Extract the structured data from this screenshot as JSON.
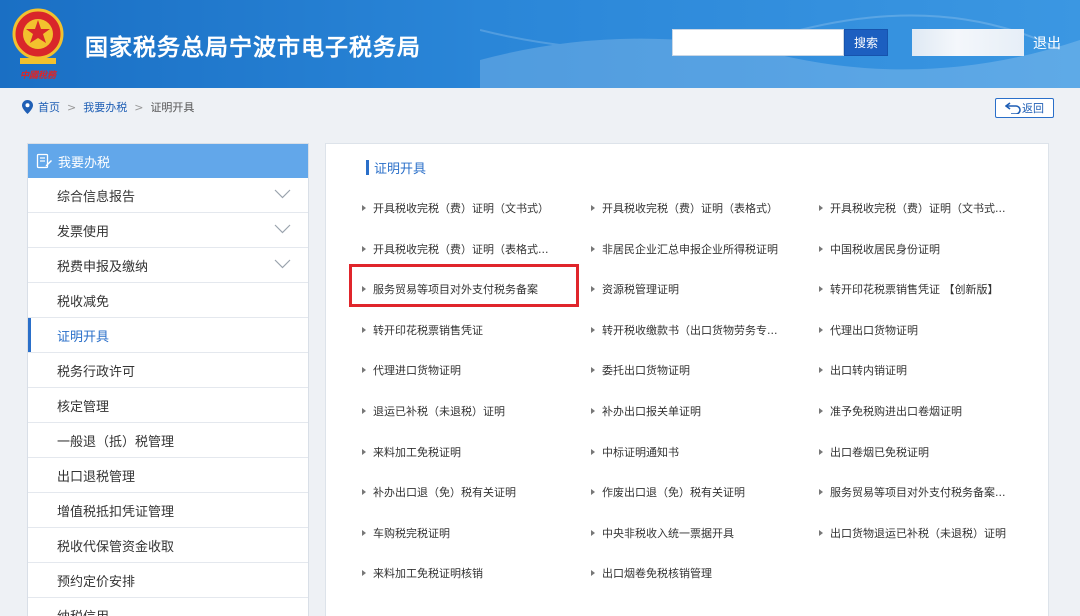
{
  "header": {
    "title": "国家税务总局宁波市电子税务局",
    "search_placeholder": "",
    "search_button": "搜索",
    "logout": "退出",
    "emblem_text": "中国税务"
  },
  "breadcrumb": {
    "home": "首页",
    "level1": "我要办税",
    "current": "证明开具",
    "separator": ">",
    "back": "返回"
  },
  "sidebar": {
    "header": "我要办税",
    "items": [
      {
        "label": "综合信息报告",
        "expandable": true
      },
      {
        "label": "发票使用",
        "expandable": true
      },
      {
        "label": "税费申报及缴纳",
        "expandable": true
      },
      {
        "label": "税收减免",
        "expandable": false
      },
      {
        "label": "证明开具",
        "expandable": false,
        "active": true
      },
      {
        "label": "税务行政许可",
        "expandable": false
      },
      {
        "label": "核定管理",
        "expandable": false
      },
      {
        "label": "一般退（抵）税管理",
        "expandable": false
      },
      {
        "label": "出口退税管理",
        "expandable": false
      },
      {
        "label": "增值税抵扣凭证管理",
        "expandable": false
      },
      {
        "label": "税收代保管资金收取",
        "expandable": false
      },
      {
        "label": "预约定价安排",
        "expandable": false
      },
      {
        "label": "纳税信用",
        "expandable": false
      }
    ]
  },
  "main": {
    "title": "证明开具",
    "items": [
      [
        "开具税收完税（费）证明（文书式）",
        "开具税收完税（费）证明（表格式）",
        "开具税收完税（费）证明（文书式..."
      ],
      [
        "开具税收完税（费）证明（表格式...",
        "非居民企业汇总申报企业所得税证明",
        "中国税收居民身份证明"
      ],
      [
        "服务贸易等项目对外支付税务备案",
        "资源税管理证明",
        "转开印花税票销售凭证 【创新版】"
      ],
      [
        "转开印花税票销售凭证",
        "转开税收缴款书（出口货物劳务专...",
        "代理出口货物证明"
      ],
      [
        "代理进口货物证明",
        "委托出口货物证明",
        "出口转内销证明"
      ],
      [
        "退运已补税（未退税）证明",
        "补办出口报关单证明",
        "准予免税购进出口卷烟证明"
      ],
      [
        "来料加工免税证明",
        "中标证明通知书",
        "出口卷烟已免税证明"
      ],
      [
        "补办出口退（免）税有关证明",
        "作废出口退（免）税有关证明",
        "服务贸易等项目对外支付税务备案..."
      ],
      [
        "车购税完税证明",
        "中央非税收入统一票据开具",
        "出口货物退运已补税（未退税）证明"
      ],
      [
        "来料加工免税证明核销",
        "出口烟卷免税核销管理",
        ""
      ]
    ],
    "highlighted_item": "服务贸易等项目对外支付税务备案"
  },
  "colors": {
    "header_blue": "#2a86d8",
    "accent_blue": "#2a6fc9",
    "sidebar_head": "#62a7ea",
    "highlight_red": "#e0252b"
  }
}
